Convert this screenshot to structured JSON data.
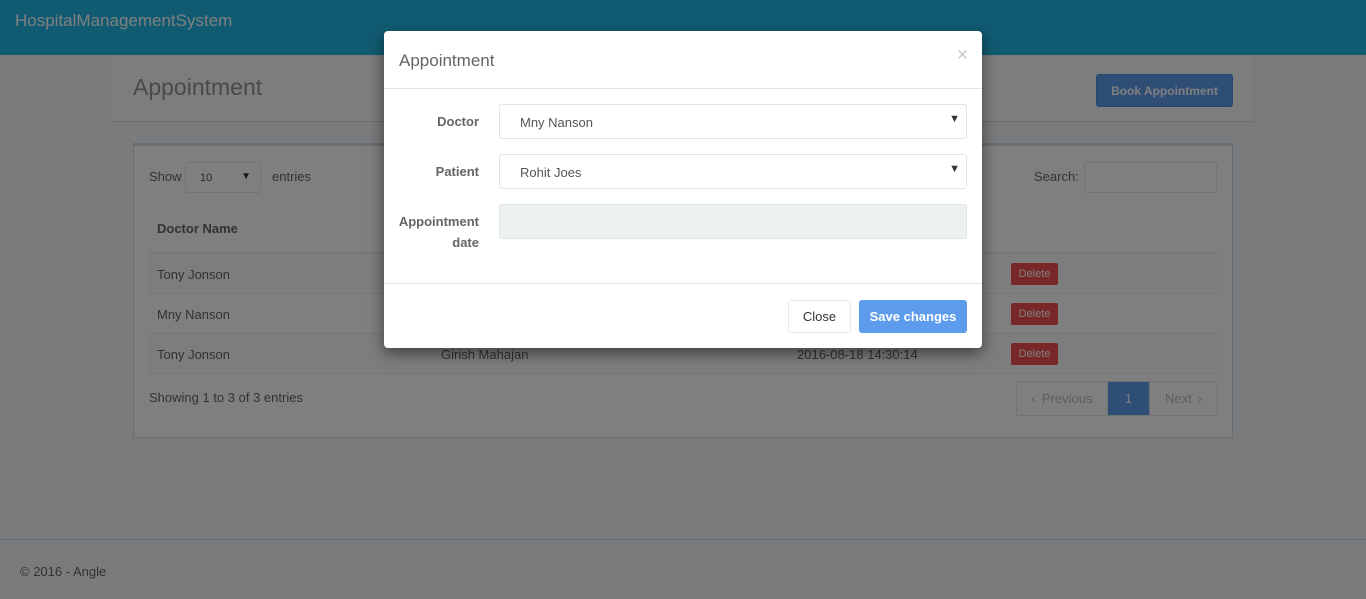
{
  "navbar": {
    "brand": "HospitalManagementSystem"
  },
  "heading": {
    "title": "Appointment",
    "book_button": "Book Appointment"
  },
  "table": {
    "length_label_before": "Show",
    "length_value": "10",
    "length_label_after": "entries",
    "search_label": "Search:",
    "columns": [
      "Doctor Name"
    ],
    "rows": [
      {
        "doctor": "Tony Jonson",
        "patient": "",
        "date": "",
        "action": "Delete"
      },
      {
        "doctor": "Mny Nanson",
        "patient": "",
        "date": "",
        "action": "Delete"
      },
      {
        "doctor": "Tony Jonson",
        "patient": "Girish Mahajan",
        "date": "2016-08-18 14:30:14",
        "action": "Delete"
      }
    ],
    "info": "Showing 1 to 3 of 3 entries",
    "pagination": {
      "previous": "Previous",
      "current": "1",
      "next": "Next"
    }
  },
  "footer": {
    "text": "© 2016 - Angle"
  },
  "modal": {
    "title": "Appointment",
    "close_symbol": "×",
    "doctor_label": "Doctor",
    "doctor_value": "Mny Nanson",
    "patient_label": "Patient",
    "patient_value": "Rohit Joes",
    "date_label_line1": "Appointment",
    "date_label_line2": "date",
    "close_button": "Close",
    "save_button": "Save changes"
  },
  "colors": {
    "navbar": "#23b7e5",
    "primary": "#5d9cec",
    "danger": "#f05050"
  },
  "icons": {
    "select_caret": "caret-down-icon",
    "modal_close": "close-icon"
  }
}
